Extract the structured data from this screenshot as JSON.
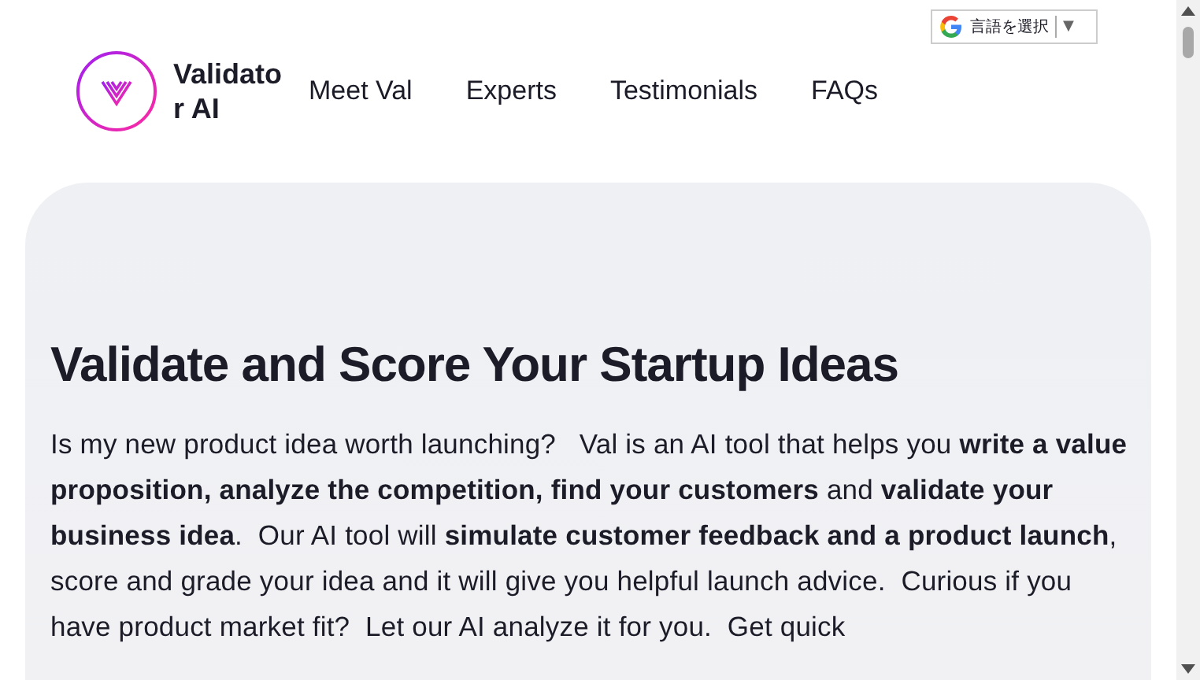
{
  "translate_widget": {
    "label": "言語を選択",
    "caret": "▼"
  },
  "brand": {
    "name": "Validato r AI"
  },
  "nav": [
    {
      "label": "Meet Val"
    },
    {
      "label": "Experts"
    },
    {
      "label": "Testimonials"
    },
    {
      "label": "FAQs"
    }
  ],
  "hero": {
    "heading": "Validate and Score Your Startup Ideas",
    "paragraph": "Is my new product idea worth launching?   Val is an AI tool that helps you **write a value proposition, analyze the competition, find your customers** and **validate your business idea**.  Our AI tool will **simulate customer feedback and a product launch**, score and grade your idea and it will give you helpful launch advice.  Curious if you have product market fit?  Let our AI analyze it for you.  Get quick"
  }
}
